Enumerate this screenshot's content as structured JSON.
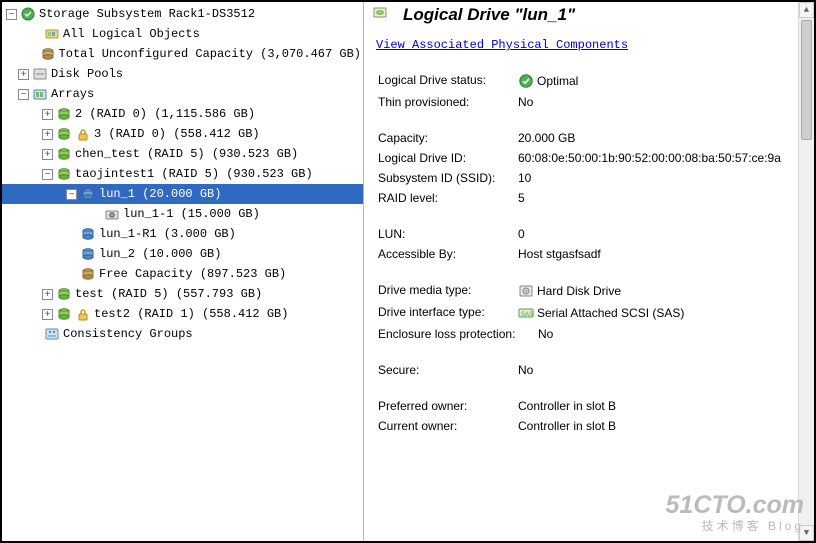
{
  "tree": {
    "root": {
      "label": "Storage Subsystem Rack1-DS3512"
    },
    "all_logical": {
      "label": "All Logical Objects"
    },
    "unconf_cap": {
      "label": "Total Unconfigured Capacity (3,070.467 GB)"
    },
    "disk_pools": {
      "label": "Disk Pools"
    },
    "arrays": {
      "label": "Arrays"
    },
    "arr_2": {
      "label": "2 (RAID 0) (1,115.586 GB)"
    },
    "arr_3": {
      "label": "3 (RAID 0) (558.412 GB)"
    },
    "arr_chen": {
      "label": "chen_test (RAID 5) (930.523 GB)"
    },
    "arr_taojin": {
      "label": "taojintest1 (RAID 5) (930.523 GB)"
    },
    "lun1": {
      "label": "lun_1 (20.000 GB)"
    },
    "lun1_1": {
      "label": "lun_1-1 (15.000 GB)"
    },
    "lun1_r1": {
      "label": "lun_1-R1 (3.000 GB)"
    },
    "lun2": {
      "label": "lun_2 (10.000 GB)"
    },
    "free_cap": {
      "label": "Free Capacity (897.523 GB)"
    },
    "arr_test": {
      "label": "test (RAID 5) (557.793 GB)"
    },
    "arr_test2": {
      "label": "test2 (RAID 1) (558.412 GB)"
    },
    "consistency": {
      "label": "Consistency Groups"
    }
  },
  "right": {
    "title": "Logical Drive \"lun_1\"",
    "assoc_link": "View Associated Physical Components",
    "rows": {
      "status_lbl": "Logical Drive status:",
      "status_val": "Optimal",
      "thin_lbl": "Thin provisioned:",
      "thin_val": "No",
      "cap_lbl": "Capacity:",
      "cap_val": "20.000 GB",
      "ldid_lbl": "Logical Drive ID:",
      "ldid_val": "60:08:0e:50:00:1b:90:52:00:00:08:ba:50:57:ce:9a",
      "ssid_lbl": "Subsystem ID (SSID):",
      "ssid_val": "10",
      "raid_lbl": "RAID level:",
      "raid_val": "5",
      "lun_lbl": "LUN:",
      "lun_val": "0",
      "acc_lbl": "Accessible By:",
      "acc_val": "Host stgasfsadf",
      "media_lbl": "Drive media type:",
      "media_val": "Hard Disk Drive",
      "iface_lbl": "Drive interface type:",
      "iface_val": "Serial Attached SCSI (SAS)",
      "enc_lbl": "Enclosure loss protection:",
      "enc_val": "No",
      "sec_lbl": "Secure:",
      "sec_val": "No",
      "pown_lbl": "Preferred owner:",
      "pown_val": "Controller in slot B",
      "cown_lbl": "Current owner:",
      "cown_val": "Controller in slot B"
    }
  },
  "watermark": {
    "big": "51CTO.com",
    "small": "技术博客  Blog"
  }
}
